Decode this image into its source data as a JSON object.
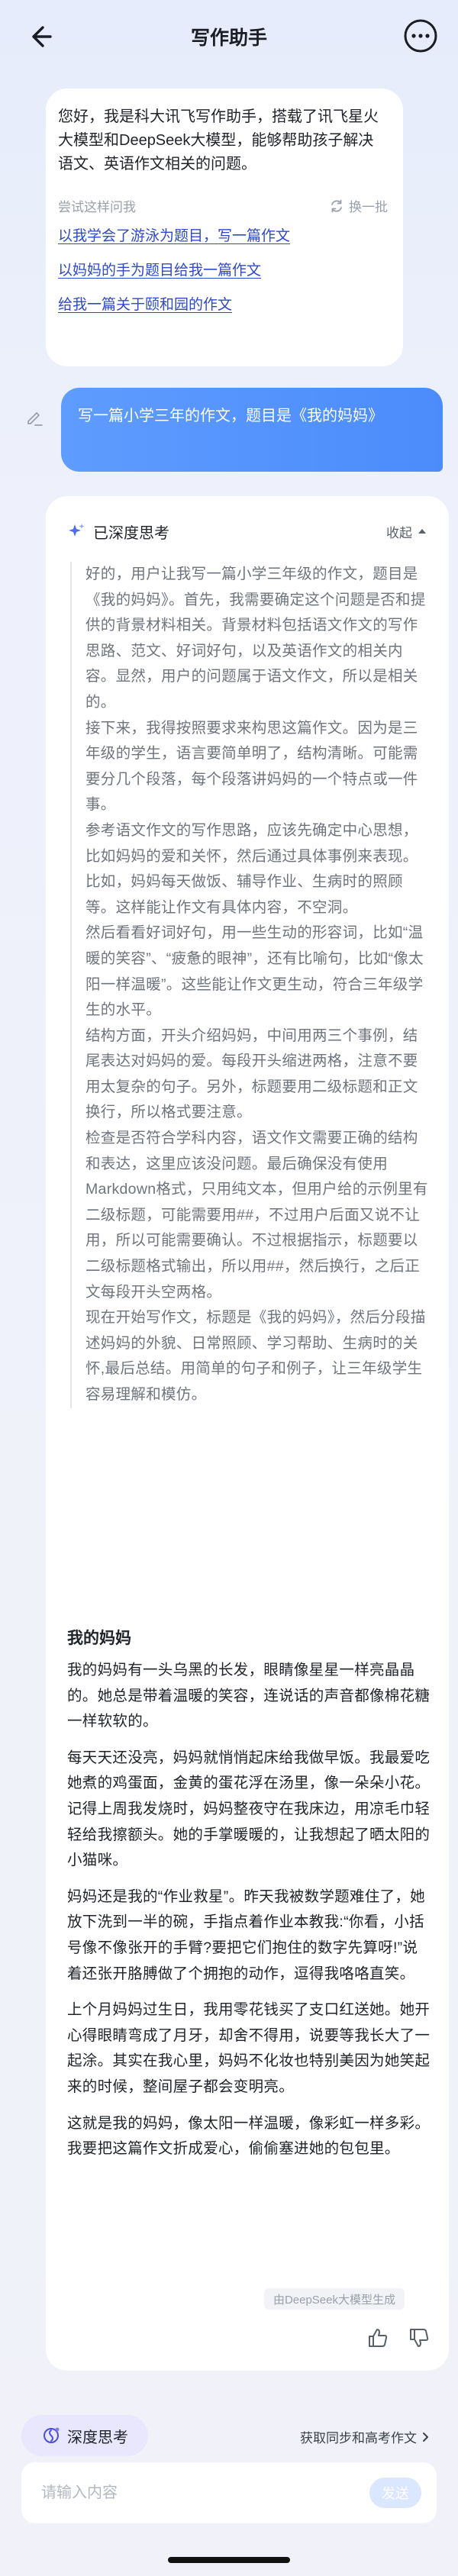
{
  "header": {
    "title": "写作助手",
    "back_icon": "arrow-left-icon",
    "more_icon": "more-horizontal-icon"
  },
  "intro": {
    "text": "您好，我是科大讯飞写作助手，搭载了讯飞星火大模型和DeepSeek大模型，能够帮助孩子解决语文、英语作文相关的问题。",
    "suggest_label": "尝试这样问我",
    "refresh_label": "换一批",
    "suggestions": [
      "以我学会了游泳为题目，写一篇作文",
      "以妈妈的手为题目给我一篇作文",
      "给我一篇关于颐和园的作文"
    ]
  },
  "user_message": "写一篇小学三年的作文，题目是《我的妈妈》",
  "answer": {
    "think_title": "已深度思考",
    "collapse_label": "收起",
    "think_paragraphs": [
      "好的，用户让我写一篇小学三年级的作文，题目是《我的妈妈》。首先，我需要确定这个问题是否和提供的背景材料相关。背景材料包括语文作文的写作思路、范文、好词好句，以及英语作文的相关内容。显然，用户的问题属于语文作文，所以是相关的。",
      "接下来，我得按照要求来构思这篇作文。因为是三年级的学生，语言要简单明了，结构清晰。可能需要分几个段落，每个段落讲妈妈的一个特点或一件事。",
      "参考语文作文的写作思路，应该先确定中心思想，比如妈妈的爱和关怀，然后通过具体事例来表现。比如，妈妈每天做饭、辅导作业、生病时的照顾等。这样能让作文有具体内容，不空洞。",
      "然后看看好词好句，用一些生动的形容词，比如“温暖的笑容”、“疲惫的眼神”，还有比喻句，比如“像太阳一样温暖”。这些能让作文更生动，符合三年级学生的水平。",
      "结构方面，开头介绍妈妈，中间用两三个事例，结尾表达对妈妈的爱。每段开头缩进两格，注意不要用太复杂的句子。另外，标题要用二级标题和正文换行，所以格式要注意。",
      "检查是否符合学科内容，语文作文需要正确的结构和表达，这里应该没问题。最后确保没有使用Markdown格式，只用纯文本，但用户给的示例里有二级标题，可能需要用##，不过用户后面又说不让用，所以可能需要确认。不过根据指示，标题要以二级标题格式输出，所以用##，然后换行，之后正文每段开头空两格。",
      "现在开始写作文，标题是《我的妈妈》，然后分段描述妈妈的外貌、日常照顾、学习帮助、生病时的关怀,最后总结。用简单的句子和例子，让三年级学生容易理解和模仿。"
    ],
    "essay_title": "我的妈妈",
    "essay_paragraphs": [
      "我的妈妈有一头乌黑的长发，眼睛像星星一样亮晶晶的。她总是带着温暖的笑容，连说话的声音都像棉花糖一样软软的。",
      "每天天还没亮，妈妈就悄悄起床给我做早饭。我最爱吃她煮的鸡蛋面，金黄的蛋花浮在汤里，像一朵朵小花。记得上周我发烧时，妈妈整夜守在我床边，用凉毛巾轻轻给我擦额头。她的手掌暖暖的，让我想起了晒太阳的小猫咪。",
      "妈妈还是我的“作业救星”。昨天我被数学题难住了，她放下洗到一半的碗，手指点着作业本教我:“你看，小括号像不像张开的手臂?要把它们抱住的数字先算呀!”说着还张开胳膊做了个拥抱的动作，逗得我咯咯直笑。",
      "上个月妈妈过生日，我用零花钱买了支口红送她。她开心得眼睛弯成了月牙，却舍不得用，说要等我长大了一起涂。其实在我心里，妈妈不化妆也特别美因为她笑起来的时候，整间屋子都会变明亮。",
      "这就是我的妈妈，像太阳一样温暖，像彩虹一样多彩。我要把这篇作文折成爱心，偷偷塞进她的包包里。"
    ],
    "generated_by": "由DeepSeek大模型生成"
  },
  "bottom": {
    "deep_think_label": "深度思考",
    "sync_label": "获取同步和高考作文",
    "input_placeholder": "请输入内容",
    "send_label": "发送"
  },
  "colors": {
    "accent": "#4b8cfb",
    "link": "#2f49c9",
    "deep_button_bg": "#e8e7fd"
  }
}
